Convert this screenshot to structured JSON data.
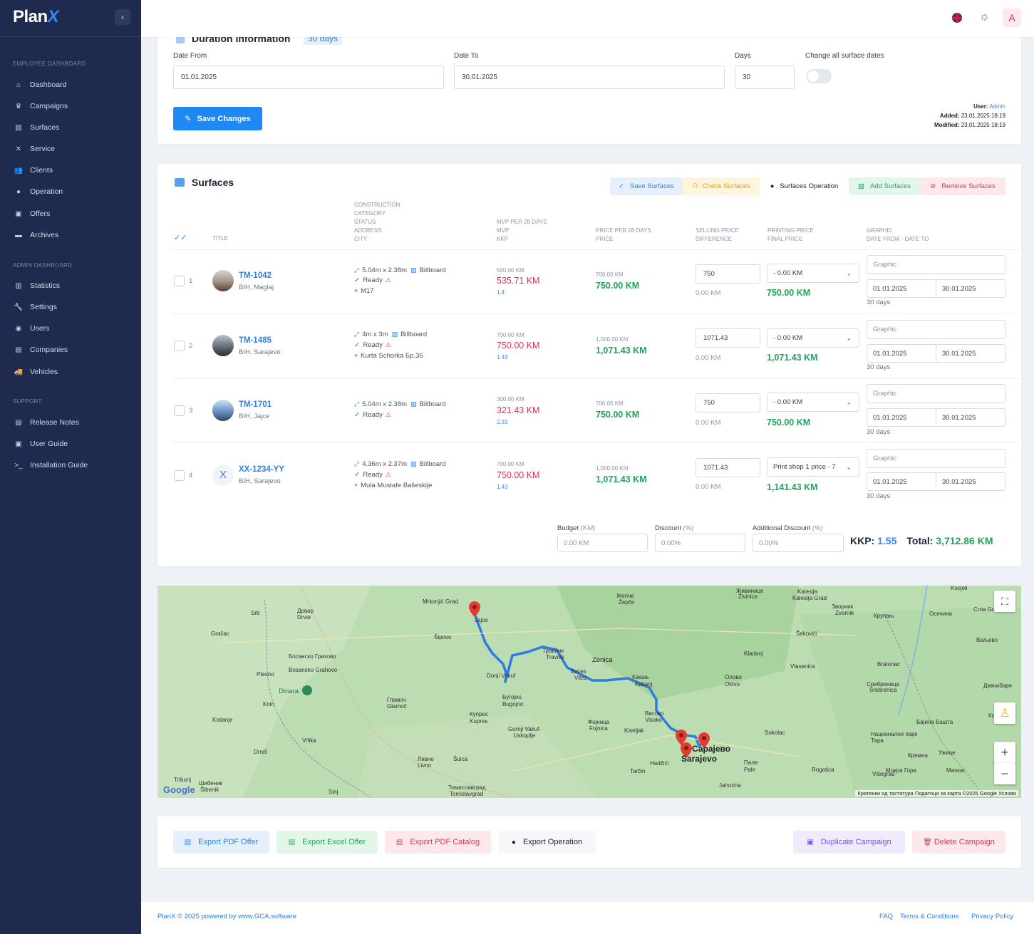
{
  "app": {
    "logo_text": "Plan",
    "logo_accent": "X"
  },
  "sidebar": {
    "sections": [
      {
        "title": "EMPLOYEE DASHBOARD",
        "items": [
          {
            "label": "Dashboard",
            "icon": "home-icon"
          },
          {
            "label": "Campaigns",
            "icon": "trophy-icon"
          },
          {
            "label": "Surfaces",
            "icon": "image-icon"
          },
          {
            "label": "Service",
            "icon": "tools-icon"
          },
          {
            "label": "Clients",
            "icon": "users-icon"
          },
          {
            "label": "Operation",
            "icon": "user-icon"
          },
          {
            "label": "Offers",
            "icon": "gift-icon"
          },
          {
            "label": "Archives",
            "icon": "folder-icon"
          }
        ]
      },
      {
        "title": "ADMIN DASHBOARD",
        "items": [
          {
            "label": "Statistics",
            "icon": "chart-icon"
          },
          {
            "label": "Settings",
            "icon": "wrench-icon"
          },
          {
            "label": "Users",
            "icon": "user-circle-icon"
          },
          {
            "label": "Companies",
            "icon": "building-icon"
          },
          {
            "label": "Vehicles",
            "icon": "truck-icon"
          }
        ]
      },
      {
        "title": "SUPPORT",
        "items": [
          {
            "label": "Release Notes",
            "icon": "file-icon"
          },
          {
            "label": "User Guide",
            "icon": "book-icon"
          },
          {
            "label": "Installation Guide",
            "icon": "terminal-icon"
          }
        ]
      }
    ]
  },
  "topbar": {
    "avatar_letter": "A"
  },
  "duration": {
    "title": "Duration Information",
    "badge": "30 days",
    "date_from_label": "Date From",
    "date_from": "01.01.2025",
    "date_to_label": "Date To",
    "date_to": "30.01.2025",
    "days_label": "Days",
    "days": "30",
    "change_all_label": "Change all surface dates",
    "save_label": "Save Changes",
    "meta": {
      "user_label": "User:",
      "user": "Admin",
      "added_label": "Added:",
      "added": "23.01.2025 18:19",
      "modified_label": "Modified:",
      "modified": "23.01.2025 18:19"
    }
  },
  "surfaces": {
    "title": "Surfaces",
    "toolbar": {
      "save": "Save Surfaces",
      "check": "Check Surfaces",
      "operation": "Surfaces Operation",
      "add": "Add Surfaces",
      "remove": "Remove Surfaces"
    },
    "headers": {
      "title": "TITLE",
      "construction": [
        "CONSTRUCTION",
        "CATEGORY",
        "STATUS",
        "ADDRESS",
        "CITY"
      ],
      "mvp": [
        "MVP PER 28 DAYS",
        "MVP",
        "KKP"
      ],
      "price": [
        "PRICE PER 28 DAYS",
        "PRICE"
      ],
      "selling": [
        "SELLING PRICE",
        "DIFFERENCE"
      ],
      "printing": [
        "PRINTING PRICE",
        "FINAL PRICE"
      ],
      "graphic": [
        "GRAPHIC",
        "DATE FROM - DATE TO"
      ]
    },
    "rows": [
      {
        "num": "1",
        "id": "TM-1042",
        "loc": "BIH, Maglaj",
        "size": "5.04m x 2.38m",
        "category": "Billboard",
        "status": "Ready",
        "address": "M17",
        "mvp28": "500.00 KM",
        "mvp": "535.71 KM",
        "kkp": "1.4",
        "price28": "700.00 KM",
        "price": "750.00 KM",
        "selling": "750",
        "difference": "0.00 KM",
        "printing": "- 0.00 KM",
        "final": "750.00 KM",
        "graphic_ph": "Graphic",
        "from": "01.01.2025",
        "to": "30.01.2025",
        "days": "30 days"
      },
      {
        "num": "2",
        "id": "TM-1485",
        "loc": "BIH, Sarajevo",
        "size": "4m x 3m",
        "category": "Billboard",
        "status": "Ready",
        "address": "Kurta Schorka Бр.36",
        "mvp28": "700.00 KM",
        "mvp": "750.00 KM",
        "kkp": "1.43",
        "price28": "1,000.00 KM",
        "price": "1,071.43 KM",
        "selling": "1071.43",
        "difference": "0.00 KM",
        "printing": "- 0.00 KM",
        "final": "1,071.43 KM",
        "graphic_ph": "Graphic",
        "from": "01.01.2025",
        "to": "30.01.2025",
        "days": "30 days"
      },
      {
        "num": "3",
        "id": "TM-1701",
        "loc": "BIH, Jajce",
        "size": "5.04m x 2.38m",
        "category": "Billboard",
        "status": "Ready",
        "address": "",
        "mvp28": "300.00 KM",
        "mvp": "321.43 KM",
        "kkp": "2.33",
        "price28": "700.00 KM",
        "price": "750.00 KM",
        "selling": "750",
        "difference": "0.00 KM",
        "printing": "- 0.00 KM",
        "final": "750.00 KM",
        "graphic_ph": "Graphic",
        "from": "01.01.2025",
        "to": "30.01.2025",
        "days": "30 days"
      },
      {
        "num": "4",
        "id": "XX-1234-YY",
        "loc": "BIH, Sarajevo",
        "size": "4.36m x 2.37m",
        "category": "Billboard",
        "status": "Ready",
        "address": "Mula Mustafe Bašeskije",
        "mvp28": "700.00 KM",
        "mvp": "750.00 KM",
        "kkp": "1.43",
        "price28": "1,000.00 KM",
        "price": "1,071.43 KM",
        "selling": "1071.43",
        "difference": "0.00 KM",
        "printing": "Print shop 1 price - 7",
        "final": "1,141.43 KM",
        "graphic_ph": "Graphic",
        "from": "01.01.2025",
        "to": "30.01.2025",
        "days": "30 days",
        "thumb_letter": "X"
      }
    ],
    "budget": {
      "label": "Budget",
      "unit": "(KM)",
      "placeholder": "0.00 KM"
    },
    "discount": {
      "label": "Discount",
      "unit": "(%)",
      "placeholder": "0.00%"
    },
    "additional": {
      "label": "Additional Discount",
      "unit": "(%)",
      "placeholder": "0.00%"
    },
    "kkp_label": "KKP:",
    "kkp_value": "1.55",
    "total_label": "Total:",
    "total_value": "3,712.86 KM"
  },
  "map": {
    "labels": [
      "Mrkonjić Grad",
      "Jajce",
      "Šipovo",
      "Drvar",
      "Дрвар",
      "Srb",
      "Gračac",
      "Bosansko Grahovo",
      "Босанско Грахово",
      "Plavno",
      "Dinara",
      "Knin",
      "Kistanje",
      "Drniš",
      "Vrlika",
      "Sinj",
      "Tribunj",
      "Šibenik",
      "Шибеник",
      "Livno",
      "Ливно",
      "Šuica",
      "Tomislavgrad",
      "Томиславград",
      "Glamoč",
      "Гламоч",
      "Kupres",
      "Купрес",
      "Bugojno",
      "Бугојно",
      "Donji Vakuf",
      "Gornji Vakuf-Uskoplje",
      "Travnik",
      "Травник",
      "Vitez",
      "Витез",
      "Zenica",
      "Kakanj",
      "Какањ",
      "Visoko",
      "Високо",
      "Fojnica",
      "Фојница",
      "Kiseljak",
      "Hadžići",
      "Tarčin",
      "Sarajevo",
      "Сарајево",
      "Pale",
      "Пале",
      "Jahorina",
      "Sokolac",
      "Rogatica",
      "Višegrad",
      "Olovo",
      "Олово",
      "Kladanj",
      "Vlasenica",
      "Bratunac",
      "Srebrenica",
      "Сребреница",
      "Šekovići",
      "Živinice",
      "Живинице",
      "Kalesija",
      "Kalesija Grad",
      "Zvornik",
      "Зворник",
      "Žepče",
      "Жепче",
      "Crna Gora",
      "Крупањ",
      "Осечина",
      "Ваљево",
      "Дивчибаре",
      "Косјерић",
      "Бајина Башта",
      "Национални парк Тара",
      "Ужице",
      "Кремна",
      "Мокра Гора",
      "Мачкат",
      "Kocjeli",
      "Косјерић"
    ],
    "attribution": "Кратенки од тастатура   Податоци за карта ©2025 Google   Услови",
    "google": "Google"
  },
  "actions": {
    "export_pdf": "Export PDF Offer",
    "export_excel": "Export Excel Offer",
    "export_catalog": "Export PDF Catalog",
    "export_operation": "Export Operation",
    "duplicate": "Duplicate Campaign",
    "delete": "Delete Campaign"
  },
  "footer": {
    "copyright": "PlanX © 2025 powered by www.GCA.software",
    "faq": "FAQ",
    "terms": "Terms & Conditions",
    "privacy": "Privacy Policy"
  },
  "colors": {
    "sidebar": "#1e2b4f",
    "primary": "#1e88f5",
    "green": "#22a35a",
    "red": "#e0364f"
  }
}
